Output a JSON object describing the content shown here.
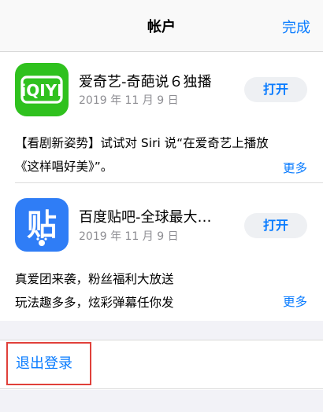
{
  "navbar": {
    "title": "帐户",
    "done_label": "完成"
  },
  "apps": [
    {
      "name": "爱奇艺-奇葩说６独播",
      "date": "2019 年 11 月 9 日",
      "open_label": "打开",
      "icon": "iqiyi-logo",
      "description_lines": [
        "【看剧新姿势】试试对 Siri 说“在爱奇艺上播放",
        "《这样唱好美》”。"
      ],
      "more_label": "更多"
    },
    {
      "name": "百度贴吧-全球最大…",
      "date": "2019 年 11 月 9 日",
      "open_label": "打开",
      "icon": "baidu-tieba-logo",
      "description_lines": [
        "真爱团来袭，粉丝福利大放送",
        "玩法趣多多，炫彩弹幕任你发"
      ],
      "more_label": "更多"
    }
  ],
  "sign_out": {
    "label": "退出登录"
  },
  "colors": {
    "accent": "#0a7cff",
    "iqiyi_green": "#2fc11e",
    "tieba_blue": "#2f7df6",
    "highlight": "#e0403a"
  }
}
